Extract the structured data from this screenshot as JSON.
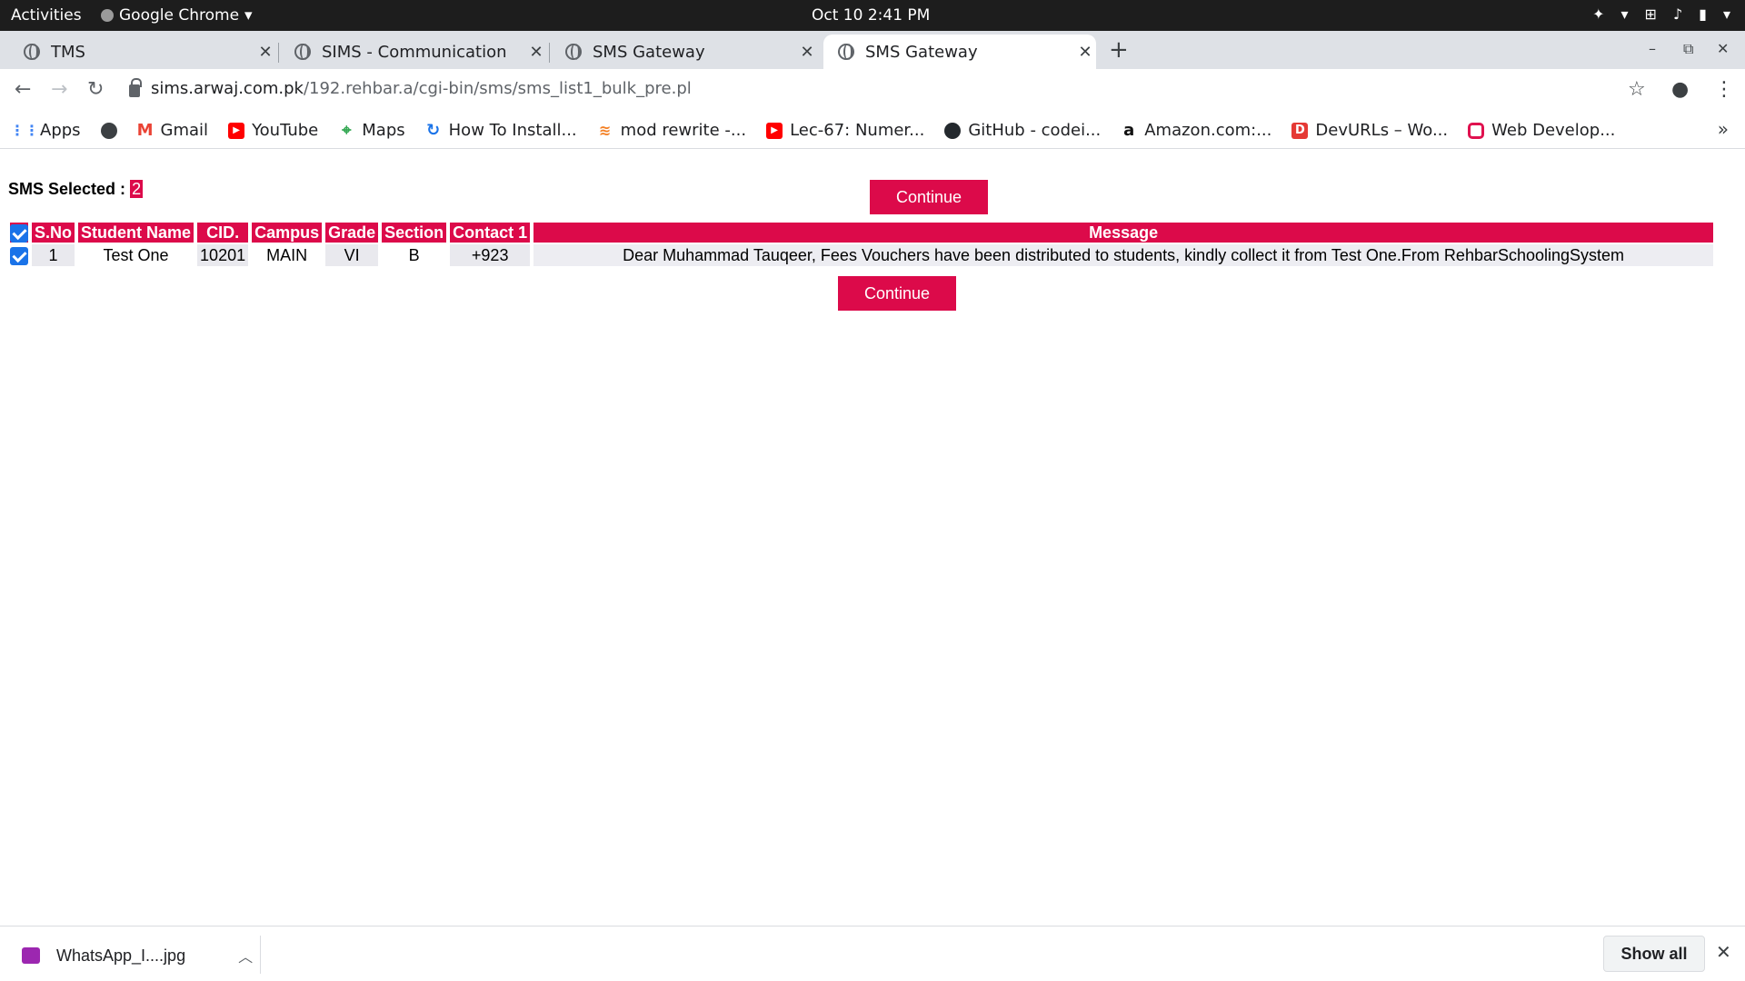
{
  "system_bar": {
    "activities": "Activities",
    "app_name": "Google Chrome",
    "clock": "Oct 10  2:41 PM"
  },
  "tabs": [
    {
      "title": "TMS"
    },
    {
      "title": "SIMS - Communication"
    },
    {
      "title": "SMS Gateway"
    },
    {
      "title": "SMS Gateway",
      "active": true
    }
  ],
  "address_bar": {
    "host": "sims.arwaj.com.pk",
    "path": "/192.rehbar.a/cgi-bin/sms/sms_list1_bulk_pre.pl"
  },
  "bookmarks": [
    {
      "label": "Apps",
      "icon": "apps-grid-icon"
    },
    {
      "label": "",
      "icon": "globe-icon"
    },
    {
      "label": "Gmail",
      "icon": "gmail-icon"
    },
    {
      "label": "YouTube",
      "icon": "youtube-icon"
    },
    {
      "label": "Maps",
      "icon": "maps-icon"
    },
    {
      "label": "How To Install...",
      "icon": "refresh-blue-icon"
    },
    {
      "label": "mod rewrite -...",
      "icon": "stackoverflow-icon"
    },
    {
      "label": "Lec-67: Numer...",
      "icon": "youtube-icon"
    },
    {
      "label": "GitHub - codei...",
      "icon": "github-icon"
    },
    {
      "label": "Amazon.com:...",
      "icon": "amazon-icon"
    },
    {
      "label": "DevURLs – Wo...",
      "icon": "devurls-icon"
    },
    {
      "label": "Web Develop...",
      "icon": "webdev-icon"
    }
  ],
  "page": {
    "sms_selected_label": "SMS Selected :",
    "sms_selected_count": "2",
    "continue_label": "Continue",
    "table": {
      "headers": [
        "S.No",
        "Student Name",
        "CID.",
        "Campus",
        "Grade",
        "Section",
        "Contact 1",
        "Message"
      ],
      "rows": [
        {
          "sno": "1",
          "student_name": "Test One",
          "cid": "10201",
          "campus": "MAIN",
          "grade": "VI",
          "section": "B",
          "contact": "+923",
          "message": "Dear Muhammad Tauqeer, Fees Vouchers have been distributed to students, kindly collect it from Test One.From RehbarSchoolingSystem"
        }
      ]
    }
  },
  "download_bar": {
    "file_name": "WhatsApp_I....jpg",
    "show_all": "Show all"
  },
  "colors": {
    "accent": "#dc0a4a",
    "checkbox": "#1a73e8"
  }
}
